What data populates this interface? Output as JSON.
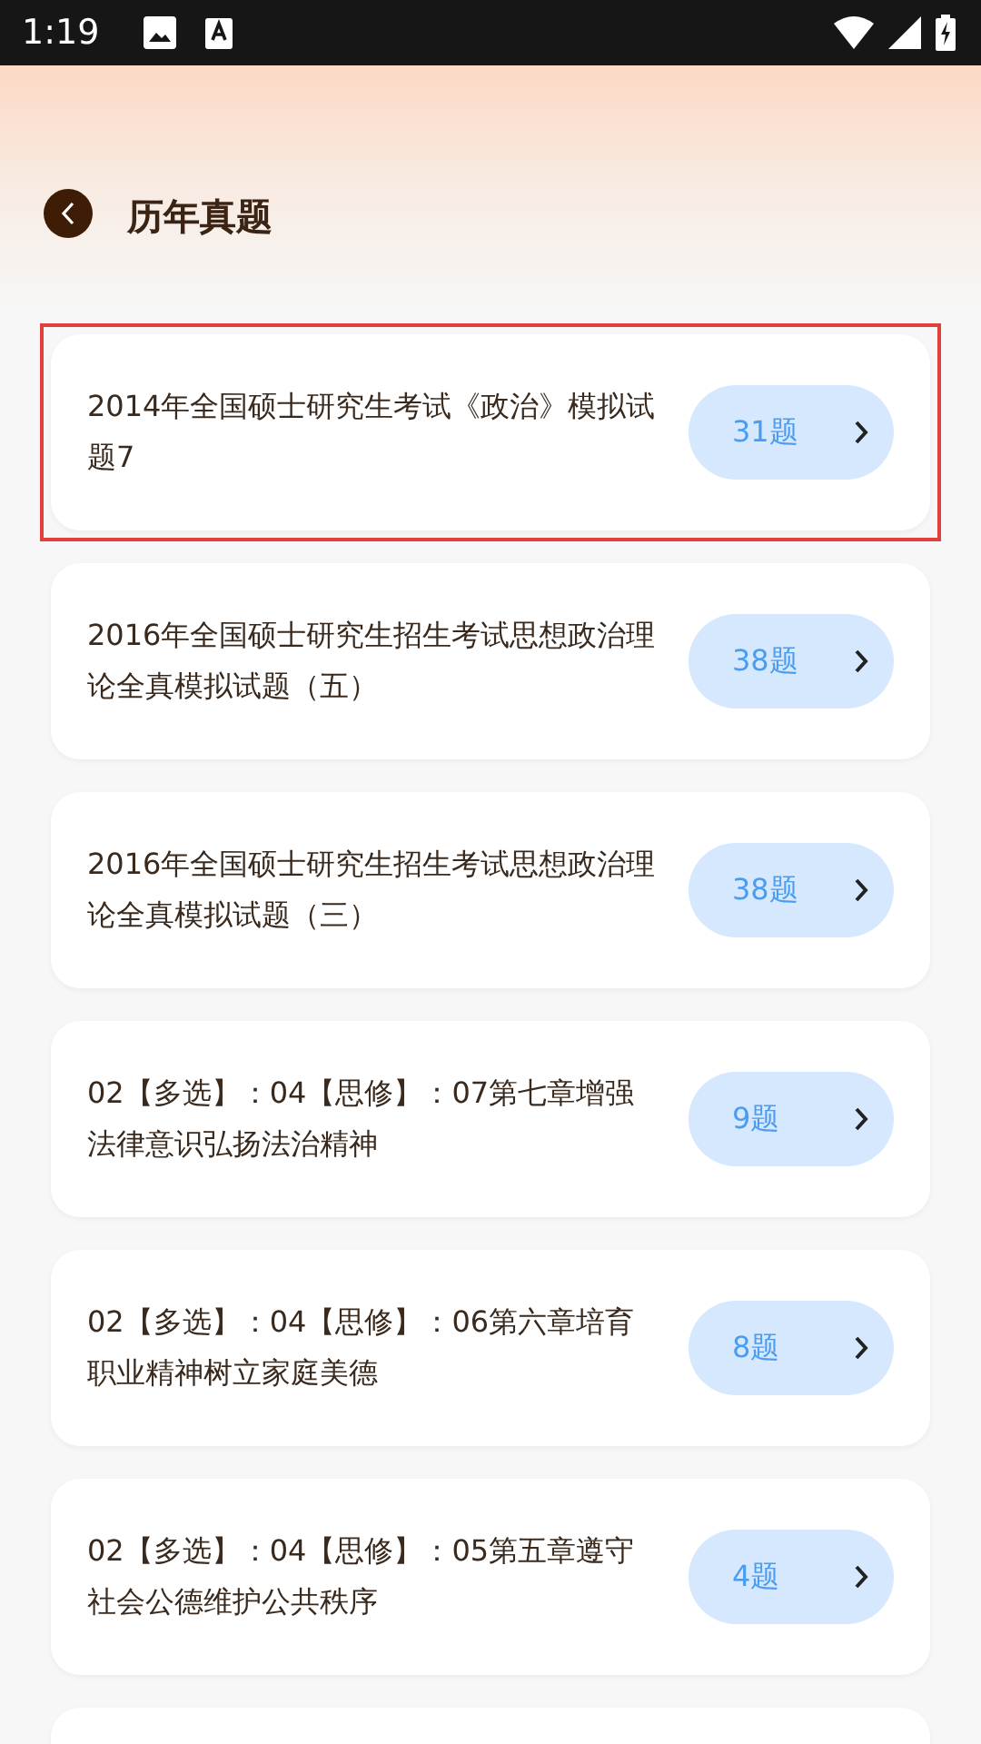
{
  "status_bar": {
    "time": "1:19"
  },
  "header": {
    "title": "历年真题"
  },
  "items": [
    {
      "title": "2014年全国硕士研究生考试《政治》模拟试题7",
      "count": "31题",
      "selected": true
    },
    {
      "title": "2016年全国硕士研究生招生考试思想政治理论全真模拟试题（五）",
      "count": "38题",
      "selected": false
    },
    {
      "title": "2016年全国硕士研究生招生考试思想政治理论全真模拟试题（三）",
      "count": "38题",
      "selected": false
    },
    {
      "title": "02【多选】：04【思修】：07第七章增强法律意识弘扬法治精神",
      "count": "9题",
      "selected": false
    },
    {
      "title": "02【多选】：04【思修】：06第六章培育职业精神树立家庭美德",
      "count": "8题",
      "selected": false
    },
    {
      "title": "02【多选】：04【思修】：05第五章遵守社会公德维护公共秩序",
      "count": "4题",
      "selected": false
    }
  ]
}
